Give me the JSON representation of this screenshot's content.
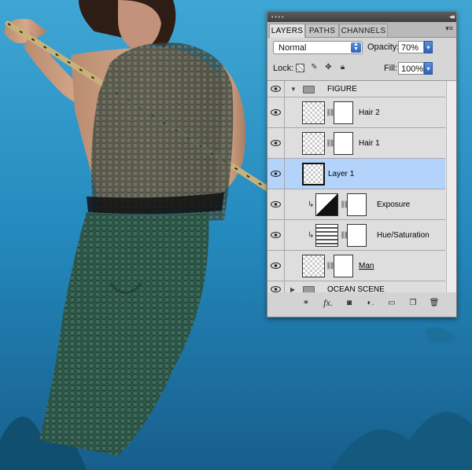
{
  "panel": {
    "tabs": [
      {
        "label": "LAYERS",
        "active": true
      },
      {
        "label": "PATHS",
        "active": false
      },
      {
        "label": "CHANNELS",
        "active": false
      }
    ],
    "blend_mode": "Normal",
    "opacity_label": "Opacity:",
    "opacity_value": "70%",
    "lock_label": "Lock:",
    "fill_label": "Fill:",
    "fill_value": "100%",
    "layers": [
      {
        "name": "FIGURE",
        "type": "group",
        "expanded": true
      },
      {
        "name": "Hair 2",
        "type": "layer-mask"
      },
      {
        "name": "Hair 1",
        "type": "layer-mask"
      },
      {
        "name": "Layer 1",
        "type": "layer",
        "selected": true
      },
      {
        "name": "Exposure",
        "type": "adjustment-clipped"
      },
      {
        "name": "Hue/Saturation",
        "type": "adjustment-clipped"
      },
      {
        "name": "Man",
        "type": "layer-mask"
      },
      {
        "name": "OCEAN SCENE",
        "type": "group",
        "expanded": false
      }
    ],
    "bottom_icons": [
      "link-icon",
      "fx-icon",
      "add-mask-icon",
      "adjustment-icon",
      "new-group-icon",
      "new-layer-icon",
      "trash-icon"
    ],
    "fx_glyph": "fx."
  },
  "colors": {
    "selection": "#b3d3fb",
    "accent": "#3a6fc6",
    "water": "#2b8ec0"
  }
}
